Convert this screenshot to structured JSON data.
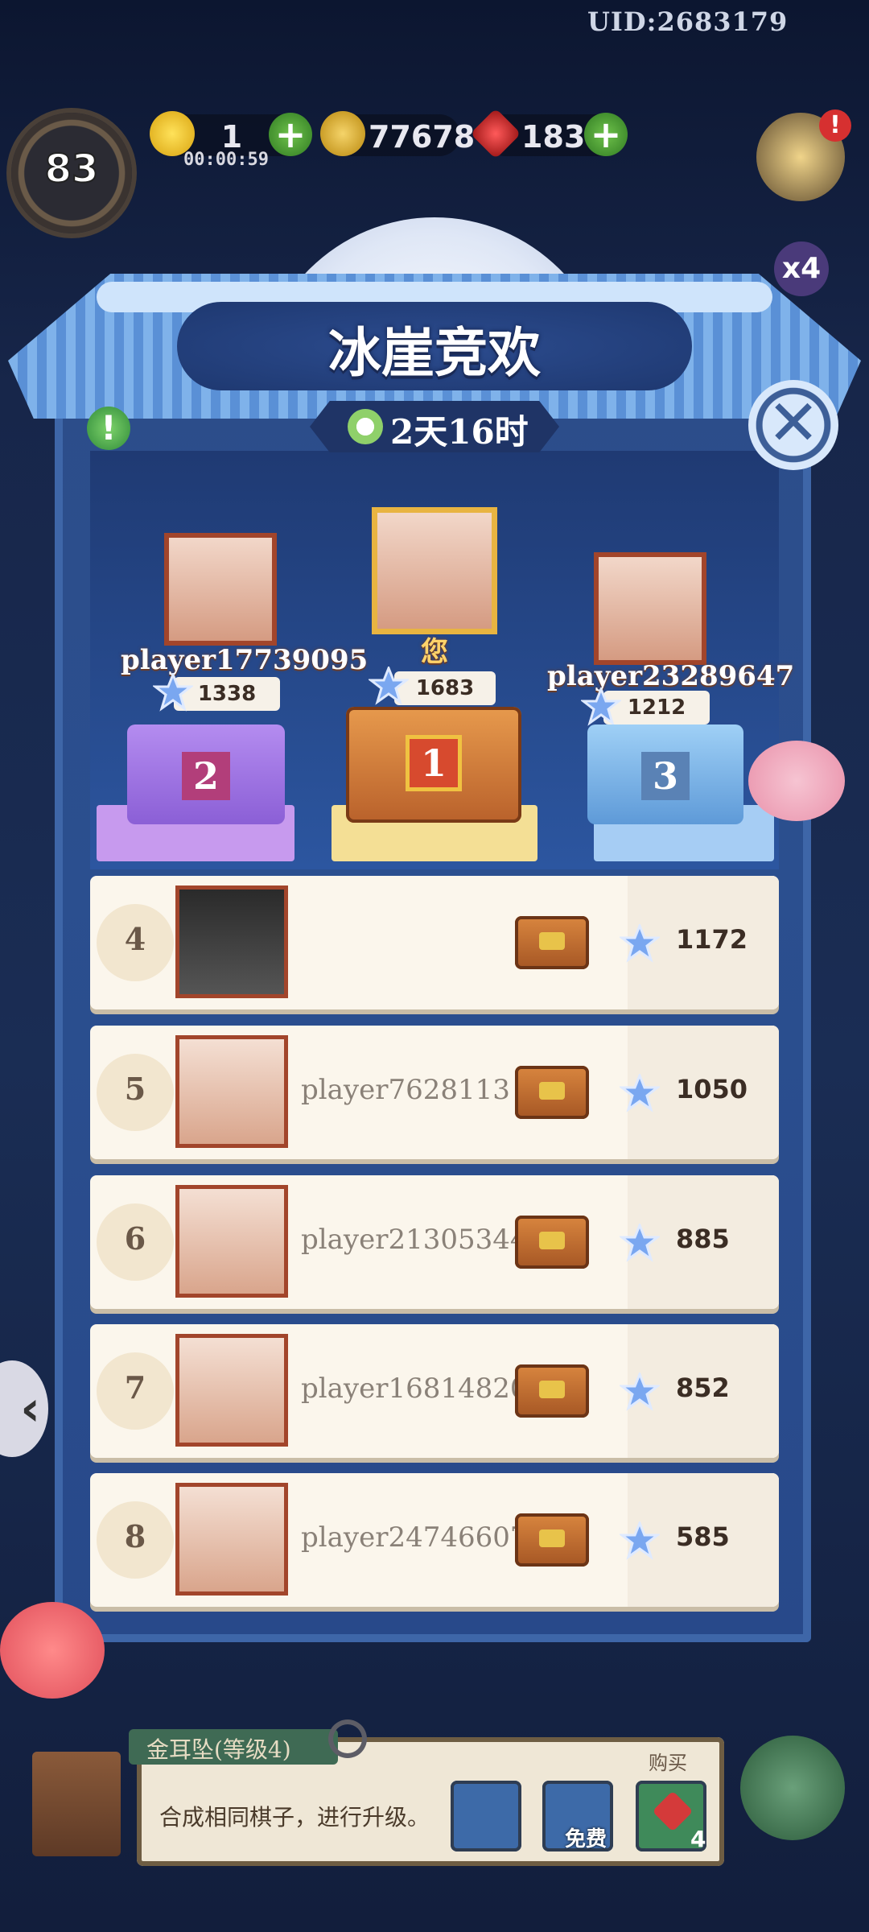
{
  "hud": {
    "uid": "UID:2683179",
    "level": "83",
    "energy": "1",
    "energy_timer": "00:00:59",
    "coins": "77678",
    "gems": "183",
    "multiplier": "x4",
    "alert": "!"
  },
  "event": {
    "title": "冰崖竞欢",
    "time_left": "2天16时",
    "info": "!",
    "close": "✕"
  },
  "podium": [
    {
      "rank": "2",
      "name": "player17739095",
      "score": "1338"
    },
    {
      "rank": "1",
      "name": "您",
      "score": "1683"
    },
    {
      "rank": "3",
      "name": "player23289647",
      "score": "1212"
    }
  ],
  "leaderboard": [
    {
      "rank": "4",
      "name": "",
      "score": "1172"
    },
    {
      "rank": "5",
      "name": "player7628113",
      "score": "1050"
    },
    {
      "rank": "6",
      "name": "player21305344",
      "score": "885"
    },
    {
      "rank": "7",
      "name": "player16814820",
      "score": "852"
    },
    {
      "rank": "8",
      "name": "player24746607",
      "score": "585"
    }
  ],
  "bottom": {
    "item_name": "金耳坠(等级4)",
    "hint": "合成相同棋子，进行升级。",
    "buy_label": "购买",
    "free_label": "免费",
    "buy_count": "4"
  },
  "colors": {
    "panel": "#2b4f8f",
    "row_bg": "#fbf6ec",
    "portrait_border": "#a2452b",
    "gold": "#e8b441",
    "silver_chest": "#9a72d6",
    "bronze_chest": "#7fb8ea"
  }
}
